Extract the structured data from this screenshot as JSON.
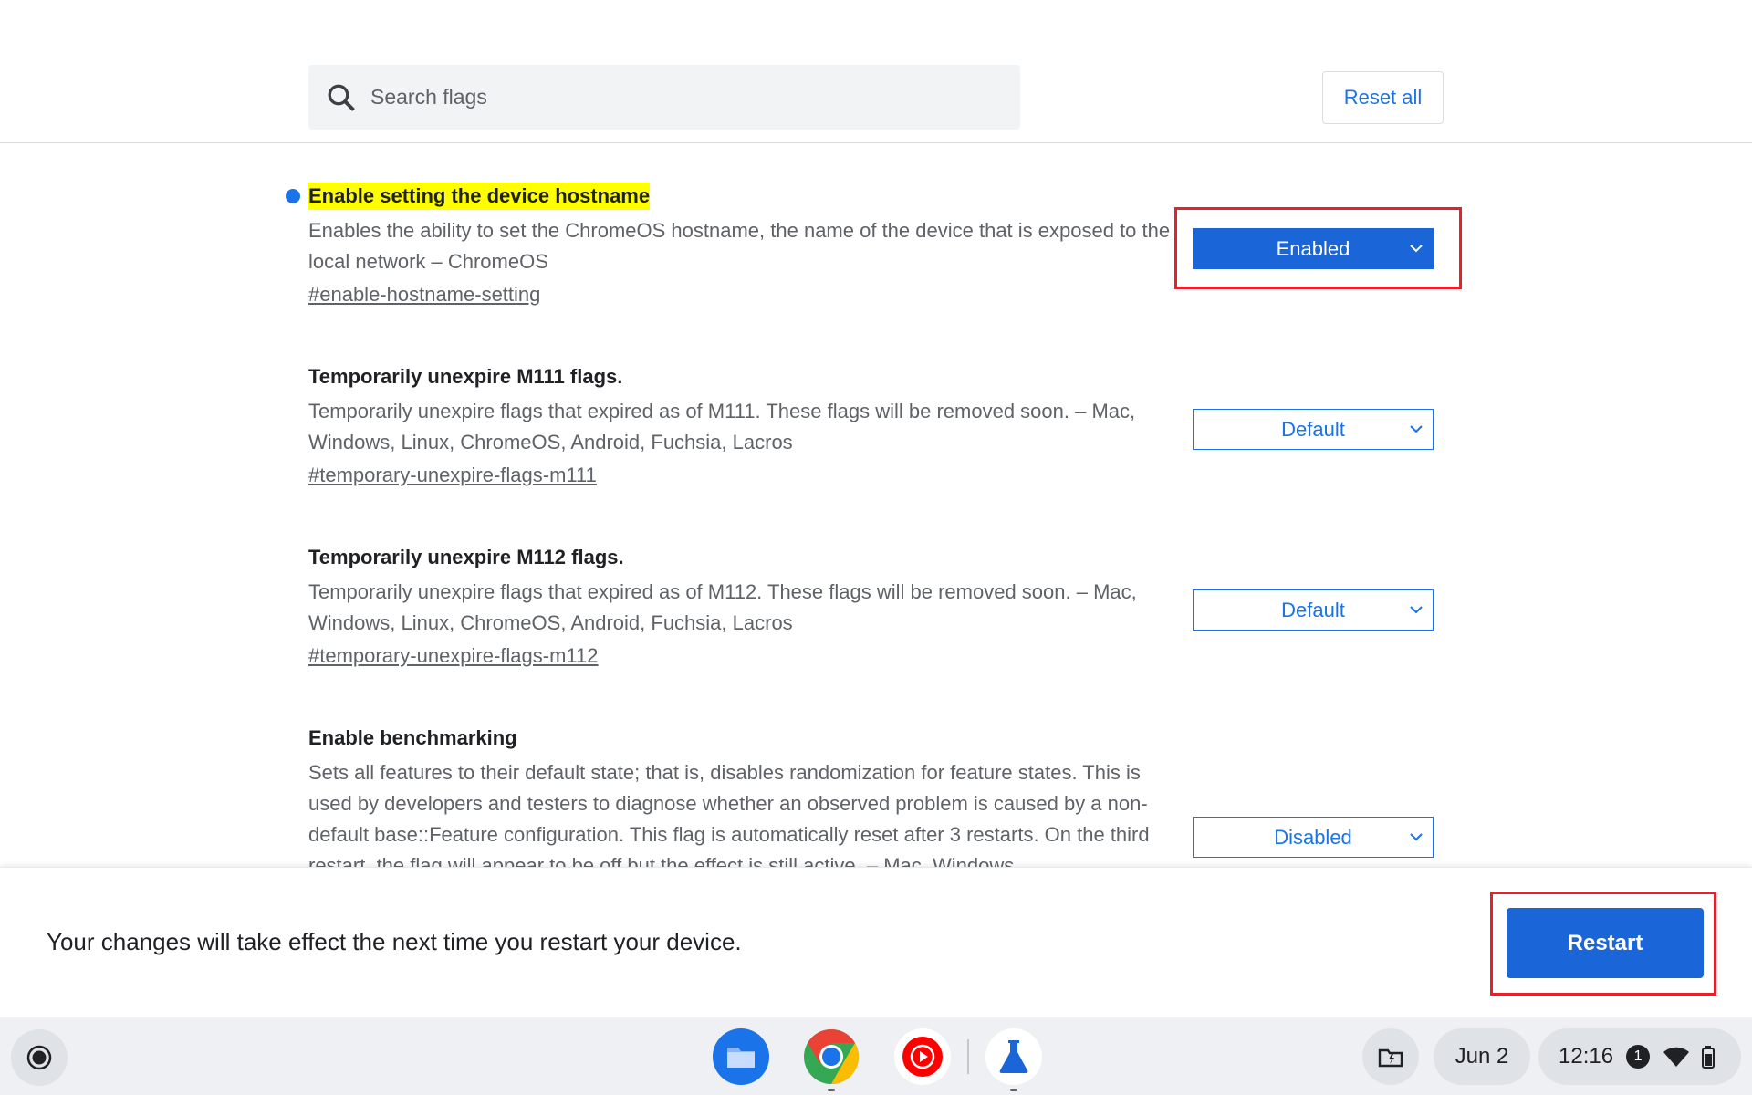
{
  "header": {
    "search_placeholder": "Search flags",
    "reset_label": "Reset all"
  },
  "flags": [
    {
      "title": "Enable setting the device hostname",
      "description": "Enables the ability to set the ChromeOS hostname, the name of the device that is exposed to the local network – ChromeOS",
      "link": "#enable-hostname-setting",
      "value": "Enabled",
      "highlighted": true,
      "modified": true
    },
    {
      "title": "Temporarily unexpire M111 flags.",
      "description": "Temporarily unexpire flags that expired as of M111. These flags will be removed soon. – Mac, Windows, Linux, ChromeOS, Android, Fuchsia, Lacros",
      "link": "#temporary-unexpire-flags-m111",
      "value": "Default"
    },
    {
      "title": "Temporarily unexpire M112 flags.",
      "description": "Temporarily unexpire flags that expired as of M112. These flags will be removed soon. – Mac, Windows, Linux, ChromeOS, Android, Fuchsia, Lacros",
      "link": "#temporary-unexpire-flags-m112",
      "value": "Default"
    },
    {
      "title": "Enable benchmarking",
      "description": "Sets all features to their default state; that is, disables randomization for feature states. This is used by developers and testers to diagnose whether an observed problem is caused by a non-default base::Feature configuration. This flag is automatically reset after 3 restarts. On the third restart, the flag will appear to be off but the effect is still active. – Mac, Windows",
      "value": "Disabled"
    }
  ],
  "restart_bar": {
    "message": "Your changes will take effect the next time you restart your device.",
    "button_label": "Restart"
  },
  "shelf": {
    "apps": [
      "files-icon",
      "chrome-icon",
      "youtube-music-icon",
      "flags-lab-icon"
    ],
    "date": "Jun 2",
    "time": "12:16",
    "notification_count": "1"
  },
  "colors": {
    "accent": "#1a73e8",
    "highlight": "#ffff00",
    "annotation_red": "#e8202b"
  }
}
